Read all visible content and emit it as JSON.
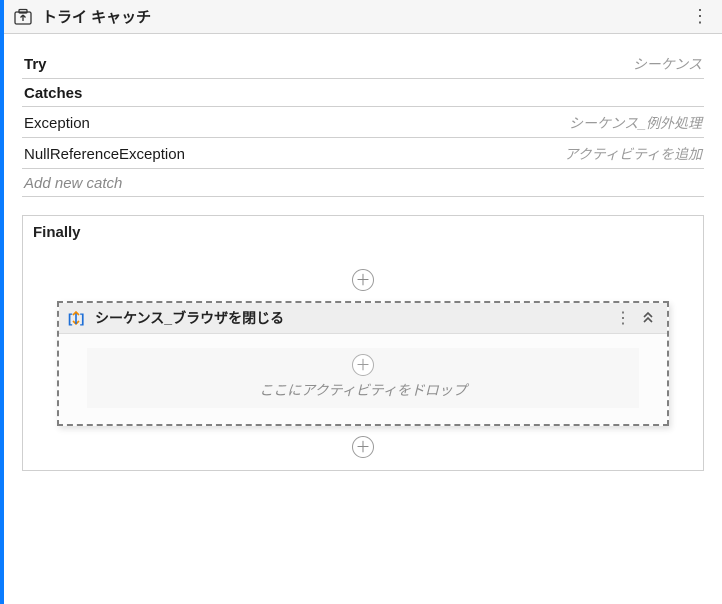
{
  "header": {
    "title": "トライ キャッチ"
  },
  "sections": {
    "try": {
      "label": "Try",
      "value": "シーケンス"
    },
    "catches": {
      "label": "Catches"
    },
    "catch_rows": [
      {
        "label": "Exception",
        "value": "シーケンス_例外処理"
      },
      {
        "label": "NullReferenceException",
        "value": "アクティビティを追加"
      }
    ],
    "add_new": {
      "label": "Add new catch"
    },
    "finally": {
      "label": "Finally"
    }
  },
  "sequence_card": {
    "title": "シーケンス_ブラウザを閉じる",
    "drop_hint": "ここにアクティビティをドロップ"
  },
  "icons": {
    "try_catch": "try-catch-icon",
    "sequence": "sequence-icon"
  }
}
